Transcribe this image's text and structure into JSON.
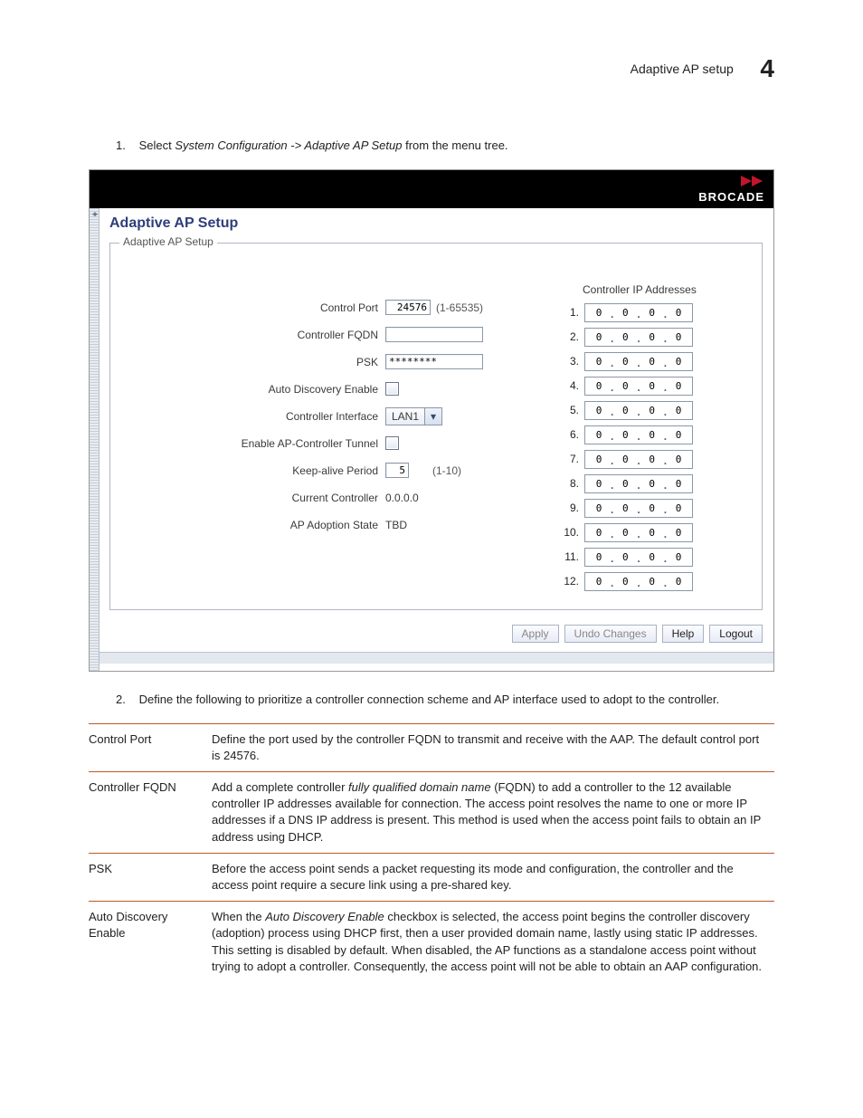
{
  "header": {
    "title": "Adaptive AP setup",
    "chapter": "4"
  },
  "steps": {
    "s1_num": "1.",
    "s1_text_a": "Select ",
    "s1_text_em": "System Configuration -> Adaptive AP Setup",
    "s1_text_b": " from the menu tree.",
    "s2_num": "2.",
    "s2_text": "Define the following to prioritize a controller connection scheme and AP interface used to adopt to the controller."
  },
  "ui": {
    "brand": "BROCADE",
    "title": "Adaptive AP Setup",
    "group_legend": "Adaptive AP Setup",
    "labels": {
      "control_port": "Control Port",
      "control_port_val": "24576",
      "control_port_hint": "(1-65535)",
      "controller_fqdn": "Controller FQDN",
      "controller_fqdn_val": "",
      "psk": "PSK",
      "psk_val": "********",
      "auto_discovery": "Auto Discovery Enable",
      "controller_interface": "Controller Interface",
      "controller_interface_val": "LAN1",
      "enable_tunnel": "Enable AP-Controller Tunnel",
      "keep_alive": "Keep-alive Period",
      "keep_alive_val": "5",
      "keep_alive_hint": "(1-10)",
      "current_controller": "Current Controller",
      "current_controller_val": "0.0.0.0",
      "adoption_state": "AP Adoption State",
      "adoption_state_val": "TBD"
    },
    "ip_header": "Controller IP Addresses",
    "ip_rows": [
      "1.",
      "2.",
      "3.",
      "4.",
      "5.",
      "6.",
      "7.",
      "8.",
      "9.",
      "10.",
      "11.",
      "12."
    ],
    "ip_oct": "0",
    "buttons": {
      "apply": "Apply",
      "undo": "Undo Changes",
      "help": "Help",
      "logout": "Logout"
    }
  },
  "desc": {
    "r1_term": "Control Port",
    "r1_body": "Define the port used by the controller FQDN to transmit and receive with the AAP. The default control port is 24576.",
    "r2_term": "Controller FQDN",
    "r2_a": "Add a complete controller ",
    "r2_em": "fully qualified domain name",
    "r2_b": " (FQDN) to add a controller to the 12 available controller IP addresses available for connection. The access point resolves the name to one or more IP addresses if a DNS IP address is present. This method is used when the access point fails to obtain an IP address using DHCP.",
    "r3_term": "PSK",
    "r3_body": "Before the access point sends a packet requesting its mode and configuration, the controller and the access point require a secure link using a pre-shared key.",
    "r4_term": "Auto Discovery Enable",
    "r4_a": "When the ",
    "r4_em": "Auto Discovery Enable",
    "r4_b": " checkbox is selected, the access point begins the controller discovery (adoption) process using DHCP first, then a user provided domain name, lastly using static IP addresses. This setting is disabled by default. When disabled, the AP functions as a standalone access point without trying to adopt a controller. Consequently, the access point will not be able to obtain an AAP configuration."
  }
}
